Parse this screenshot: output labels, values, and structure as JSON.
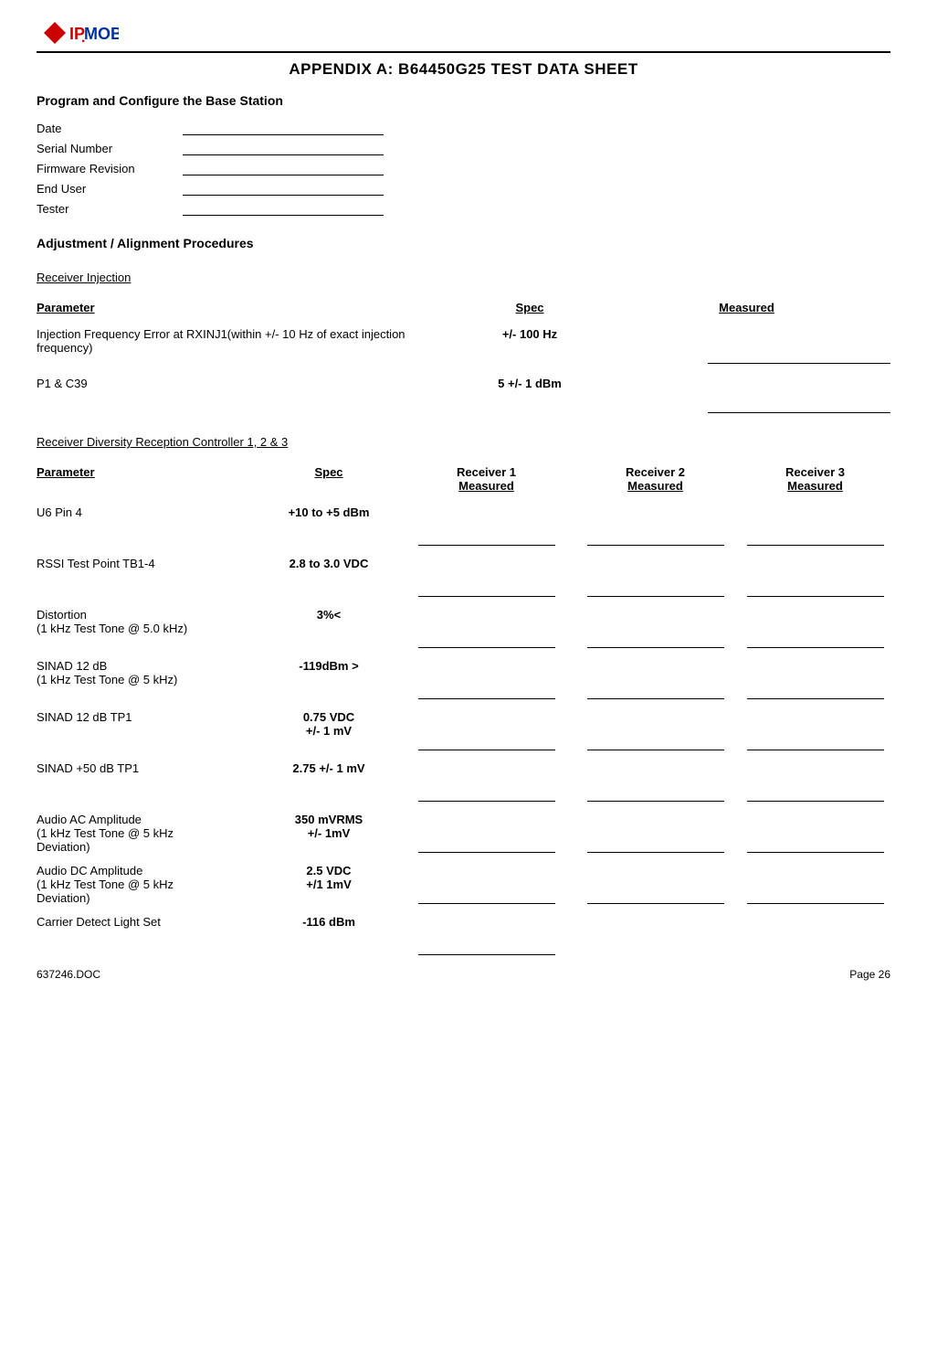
{
  "logo": {
    "ip": "IP",
    "mobilenet": "MOBILENET",
    "dot": ".",
    "tag": "IPMOBILENET"
  },
  "page_title": "APPENDIX A:  B64450G25 TEST DATA SHEET",
  "sections": {
    "program_heading": "Program and Configure the Base Station",
    "info_fields": [
      {
        "label": "Date"
      },
      {
        "label": "Serial Number"
      },
      {
        "label": "Firmware Revision"
      },
      {
        "label": "End User"
      },
      {
        "label": "Tester"
      }
    ],
    "alignment_heading": "Adjustment / Alignment Procedures",
    "receiver_injection_label": "Receiver Injection",
    "ri_table": {
      "col_param": "Parameter",
      "col_spec": "Spec",
      "col_measured": "Measured",
      "rows": [
        {
          "param": "Injection Frequency Error at RXINJ1(within +/- 10 Hz of exact injection frequency)",
          "spec": "+/- 100 Hz"
        },
        {
          "param": "P1 & C39",
          "spec": "5 +/- 1 dBm"
        }
      ]
    },
    "diversity_label": "Receiver Diversity Reception Controller 1, 2 & 3",
    "div_table": {
      "col_param": "Parameter",
      "col_spec": "Spec",
      "col_r1_line1": "Receiver 1",
      "col_r1_line2": "Measured",
      "col_r2_line1": "Receiver 2",
      "col_r2_line2": "Measured",
      "col_r3_line1": "Receiver 3",
      "col_r3_line2": "Measured",
      "rows": [
        {
          "param": "U6 Pin 4",
          "spec": "+10 to +5 dBm"
        },
        {
          "param": "RSSI Test Point TB1-4",
          "spec": "2.8 to 3.0 VDC"
        },
        {
          "param_line1": "Distortion",
          "param_line2": "(1 kHz Test Tone @ 5.0 kHz)",
          "spec": "3%<"
        },
        {
          "param_line1": "SINAD 12 dB",
          "param_line2": "(1 kHz Test Tone @ 5 kHz)",
          "spec": "-119dBm >"
        },
        {
          "param": "SINAD 12 dB TP1",
          "spec_line1": "0.75 VDC",
          "spec_line2": "+/- 1 mV"
        },
        {
          "param": "SINAD +50 dB TP1",
          "spec": "2.75 +/- 1 mV"
        },
        {
          "param_line1": "Audio AC Amplitude",
          "param_line2": "(1 kHz Test Tone @ 5 kHz",
          "param_line3": "Deviation)",
          "spec_line1": "350 mVRMS",
          "spec_line2": "+/- 1mV"
        },
        {
          "param_line1": "Audio DC Amplitude",
          "param_line2": "(1 kHz Test Tone @ 5 kHz",
          "param_line3": "Deviation)",
          "spec_line1": "2.5 VDC",
          "spec_line2": "+/1 1mV"
        },
        {
          "param": "Carrier Detect Light Set",
          "spec": "-116 dBm",
          "only_r1": true
        }
      ]
    }
  },
  "footer": {
    "doc": "637246.DOC",
    "page": "Page 26"
  }
}
